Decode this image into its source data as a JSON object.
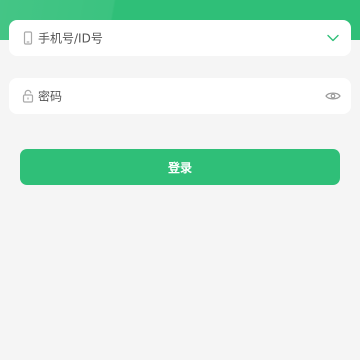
{
  "colors": {
    "accent": "#2fbf78",
    "background": "#f5f5f5",
    "card": "#ffffff",
    "icon": "#9a9a9a"
  },
  "form": {
    "phone_field": {
      "placeholder": "手机号/ID号",
      "lead_icon": "phone-icon",
      "trail_icon": "chevron-down-icon"
    },
    "password_field": {
      "placeholder": "密码",
      "lead_icon": "lock-icon",
      "trail_icon": "eye-icon"
    },
    "login_label": "登录"
  }
}
